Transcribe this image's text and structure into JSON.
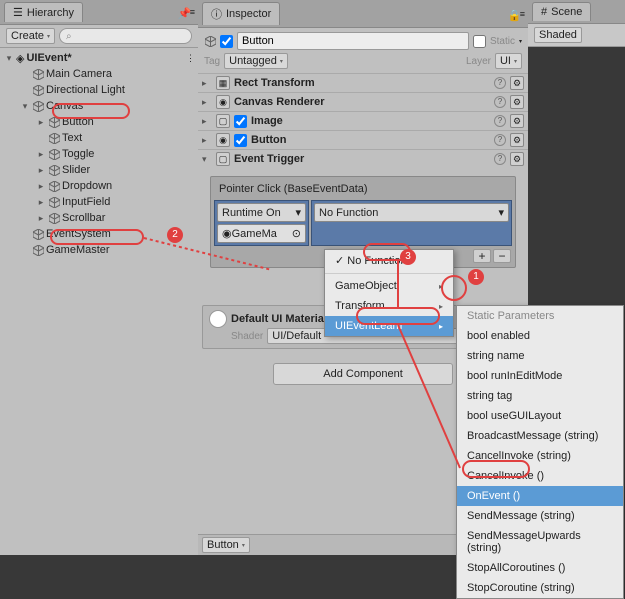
{
  "hierarchy": {
    "title": "Hierarchy",
    "create": "Create",
    "scene": "UIEvent*",
    "items": [
      "Main Camera",
      "Directional Light",
      "Canvas",
      "Button",
      "Text",
      "Toggle",
      "Slider",
      "Dropdown",
      "InputField",
      "Scrollbar",
      "EventSystem",
      "GameMaster"
    ]
  },
  "inspector": {
    "title": "Inspector",
    "obj_name": "Button",
    "static": "Static",
    "tag": "Tag",
    "tag_val": "Untagged",
    "layer": "Layer",
    "layer_val": "UI",
    "components": {
      "rect": "Rect Transform",
      "canvasr": "Canvas Renderer",
      "image": "Image",
      "button": "Button",
      "trigger": "Event Trigger"
    },
    "event": {
      "section": "Pointer Click (BaseEventData)",
      "runtime": "Runtime On",
      "func": "No Function",
      "obj": "GameMa",
      "obj_suffix": "⊙"
    },
    "material": {
      "name": "Default UI Material",
      "shader": "Shader",
      "shader_val": "UI/Default"
    },
    "add": "Add Component",
    "footer_btn": "Button"
  },
  "scene": {
    "title": "Scene",
    "mode": "Shaded"
  },
  "menu1": {
    "items": [
      "No Function",
      "GameObject",
      "Transform",
      "UIEventLearn"
    ]
  },
  "menu2": {
    "header": "Static Parameters",
    "items": [
      "bool enabled",
      "string name",
      "bool runInEditMode",
      "string tag",
      "bool useGUILayout",
      "BroadcastMessage (string)",
      "CancelInvoke (string)",
      "CancelInvoke ()",
      "OnEvent ()",
      "SendMessage (string)",
      "SendMessageUpwards (string)",
      "StopAllCoroutines ()",
      "StopCoroutine (string)"
    ]
  }
}
